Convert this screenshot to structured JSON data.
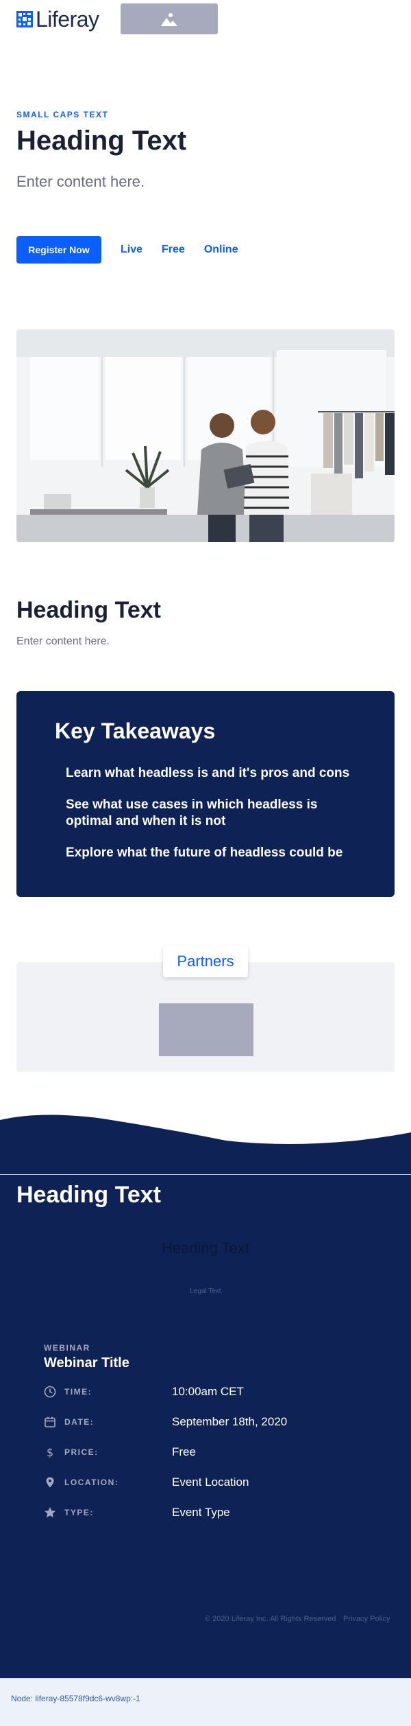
{
  "header": {
    "logo_text": "Liferay",
    "logo_icon": "liferay-logo-icon",
    "image_placeholder_icon": "image-placeholder-icon"
  },
  "hero": {
    "eyebrow": "SMALL CAPS TEXT",
    "title": "Heading Text",
    "body": "Enter content here.",
    "register_label": "Register Now",
    "links": [
      "Live",
      "Free",
      "Online"
    ]
  },
  "section": {
    "title": "Heading Text",
    "body": "Enter content here."
  },
  "takeaways": {
    "title": "Key Takeaways",
    "items": [
      "Learn what headless is and it's pros and cons",
      "See what use cases in which headless is optimal and when it is not",
      "Explore what the future of headless could be"
    ]
  },
  "partners": {
    "tab_label": "Partners"
  },
  "footer": {
    "title": "Heading Text",
    "ghost_title": "Heading Text",
    "legal": "Legal Text",
    "webinar_eyebrow": "WEBINAR",
    "webinar_title": "Webinar Title",
    "details": [
      {
        "label": "TIME:",
        "value": "10:00am CET",
        "icon": "clock-icon"
      },
      {
        "label": "DATE:",
        "value": "September 18th, 2020",
        "icon": "calendar-icon"
      },
      {
        "label": "PRICE:",
        "value": "Free",
        "icon": "dollar-icon"
      },
      {
        "label": "LOCATION:",
        "value": "Event Location",
        "icon": "map-pin-icon"
      },
      {
        "label": "TYPE:",
        "value": "Event Type",
        "icon": "star-icon"
      }
    ],
    "copyright": "© 2020 Liferay Inc. All Rights Reserved",
    "privacy": "Privacy Policy"
  },
  "node_bar": {
    "text": "Node: liferay-85578f9dc6-wv8wp:-1"
  },
  "colors": {
    "accent": "#0b5fff",
    "navy": "#0e2256",
    "placeholder_gray": "#a7a9bc"
  }
}
